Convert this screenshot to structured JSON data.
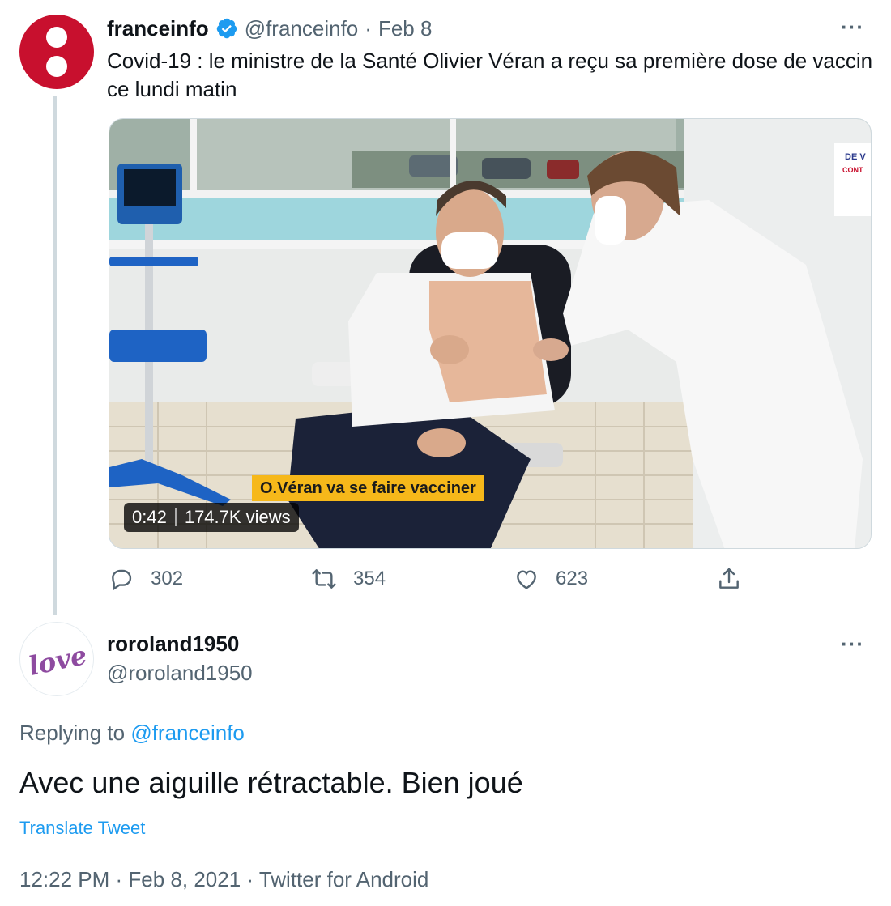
{
  "parent_tweet": {
    "display_name": "franceinfo",
    "handle": "@franceinfo",
    "separator": "·",
    "date": "Feb 8",
    "more": "···",
    "text": "Covid-19 : le ministre de la Santé Olivier Véran a reçu sa première dose de vaccin ce lundi matin",
    "media": {
      "caption": "O.Véran va se faire vacciner",
      "duration": "0:42",
      "views": "174.7K views",
      "poster_text_1": "DE V",
      "poster_text_2": "CONT"
    },
    "actions": {
      "replies": "302",
      "retweets": "354",
      "likes": "623"
    },
    "colors": {
      "brand": "#c8102e",
      "verified": "#1d9bf0"
    }
  },
  "reply_tweet": {
    "display_name": "roroland1950",
    "handle": "@roroland1950",
    "more": "···",
    "avatar_text": "love",
    "replying_prefix": "Replying to ",
    "replying_to": "@franceinfo",
    "text": "Avec une aiguille rétractable. Bien joué",
    "translate_label": "Translate Tweet",
    "time": "12:22 PM",
    "date": "Feb 8, 2021",
    "source": "Twitter for Android",
    "meta_separator": " · "
  },
  "icons": [
    "reply-icon",
    "retweet-icon",
    "like-icon",
    "share-icon",
    "verified-badge-icon",
    "more-icon"
  ]
}
